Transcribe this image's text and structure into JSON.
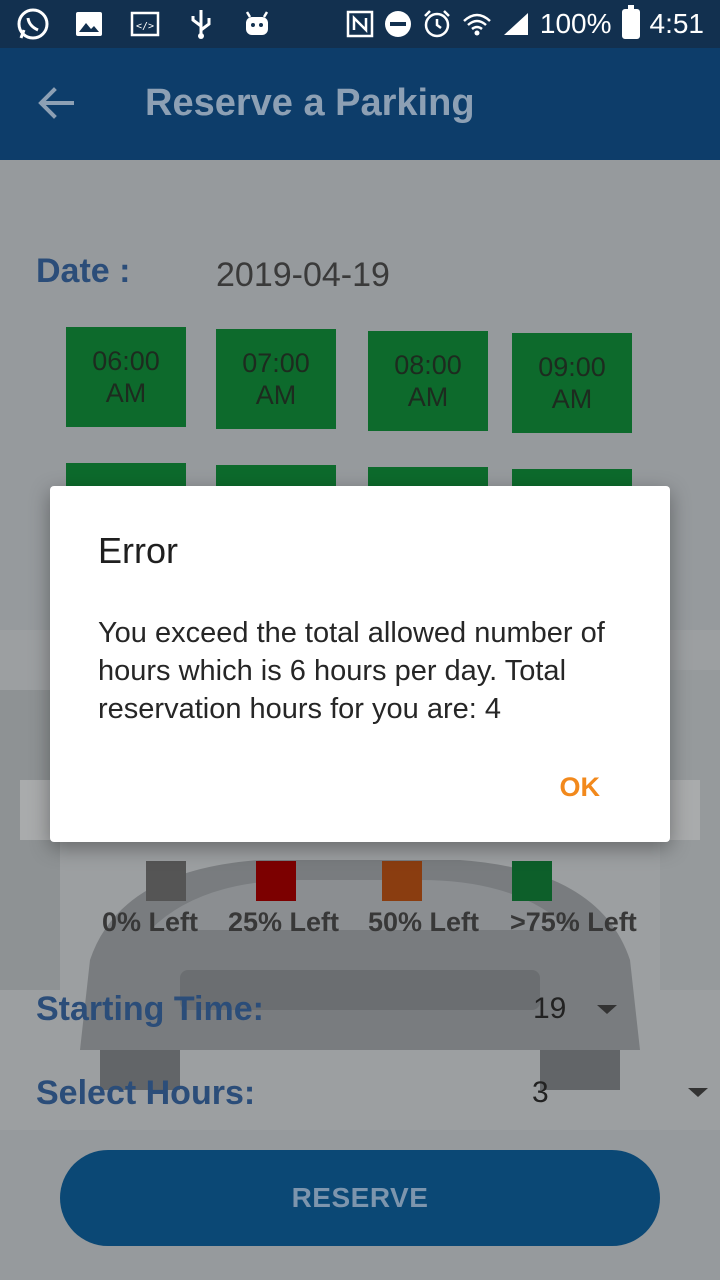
{
  "status_bar": {
    "battery": "100%",
    "time": "4:51",
    "icons": [
      "whatsapp-icon",
      "image-icon",
      "code-icon",
      "usb-icon",
      "android-icon",
      "nfc-icon",
      "do-not-disturb-icon",
      "alarm-icon",
      "wifi-icon",
      "signal-icon",
      "battery-icon"
    ]
  },
  "appbar": {
    "title": "Reserve a Parking",
    "back_icon": "arrow-back-icon"
  },
  "form": {
    "date_label": "Date :",
    "date_value": "2019-04-19",
    "slots_row1": [
      {
        "time": "06:00",
        "period": "AM"
      },
      {
        "time": "07:00",
        "period": "AM"
      },
      {
        "time": "08:00",
        "period": "AM"
      },
      {
        "time": "09:00",
        "period": "AM"
      }
    ],
    "legend": [
      {
        "label": "0% Left",
        "color": "#555555"
      },
      {
        "label": "25% Left",
        "color": "#7c0000"
      },
      {
        "label": "50% Left",
        "color": "#8a3d10"
      },
      {
        "label": ">75% Left",
        "color": "#0d5f2a"
      }
    ],
    "starting_time_label": "Starting Time:",
    "starting_time_value": "19",
    "select_hours_label": "Select Hours:",
    "select_hours_value": "3",
    "reserve_button": "RESERVE"
  },
  "dialog": {
    "title": "Error",
    "message": "You exceed the total allowed number of hours which is 6 hours per day. Total reservation hours for you are: 4",
    "ok_button": "OK"
  },
  "colors": {
    "status_bar": "#12304f",
    "app_bar": "#0d3d6a",
    "slot_green": "#0d6a2c",
    "accent_ok": "#f2891c"
  }
}
